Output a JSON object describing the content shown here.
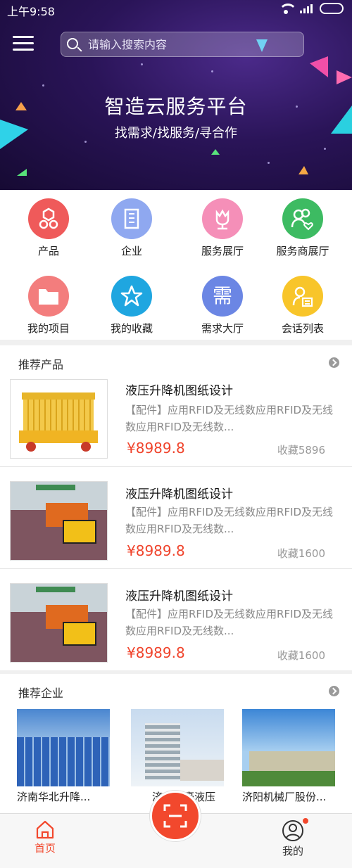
{
  "status_bar": {
    "time": "上午9:58"
  },
  "header": {
    "search_placeholder": "请输入搜索内容",
    "title": "智造云服务平台",
    "subtitle": "找需求/找服务/寻合作"
  },
  "categories": [
    {
      "label": "产品",
      "icon": "bolts-icon",
      "color": "#ef5a5a"
    },
    {
      "label": "企业",
      "icon": "building-icon",
      "color": "#8fa8f0"
    },
    {
      "label": "服务展厅",
      "icon": "flower-icon",
      "color": "#f58fb8"
    },
    {
      "label": "服务商展厅",
      "icon": "users-heart-icon",
      "color": "#3dbb62"
    },
    {
      "label": "我的项目",
      "icon": "folder-icon",
      "color": "#f37d7d"
    },
    {
      "label": "我的收藏",
      "icon": "star-icon",
      "color": "#1fa6e0"
    },
    {
      "label": "需求大厅",
      "icon": "xu-glyph-icon",
      "color": "#6b86e4"
    },
    {
      "label": "会话列表",
      "icon": "person-card-icon",
      "color": "#f8c52a"
    }
  ],
  "recommended_products": {
    "title": "推荐产品",
    "items": [
      {
        "name": "液压升降机图纸设计",
        "desc": "【配件】应用RFID及无线数应用RFID及无线数应用RFID及无线数...",
        "price": "¥8989.8",
        "fav": "收藏5896",
        "image": "scissor-lift-image"
      },
      {
        "name": "液压升降机图纸设计",
        "desc": "【配件】应用RFID及无线数应用RFID及无线数应用RFID及无线数...",
        "price": "¥8989.8",
        "fav": "收藏1600",
        "image": "road-truck-image"
      },
      {
        "name": "液压升降机图纸设计",
        "desc": "【配件】应用RFID及无线数应用RFID及无线数应用RFID及无线数...",
        "price": "¥8989.8",
        "fav": "收藏1600",
        "image": "road-truck-image"
      }
    ]
  },
  "recommended_companies": {
    "title": "推荐企业",
    "items": [
      {
        "name": "济南华北升降..."
      },
      {
        "name": "济南龙豪液压"
      },
      {
        "name": "济阳机械厂股份..."
      }
    ]
  },
  "tabbar": {
    "home": "首页",
    "mine": "我的",
    "accent": "#f2482d"
  }
}
